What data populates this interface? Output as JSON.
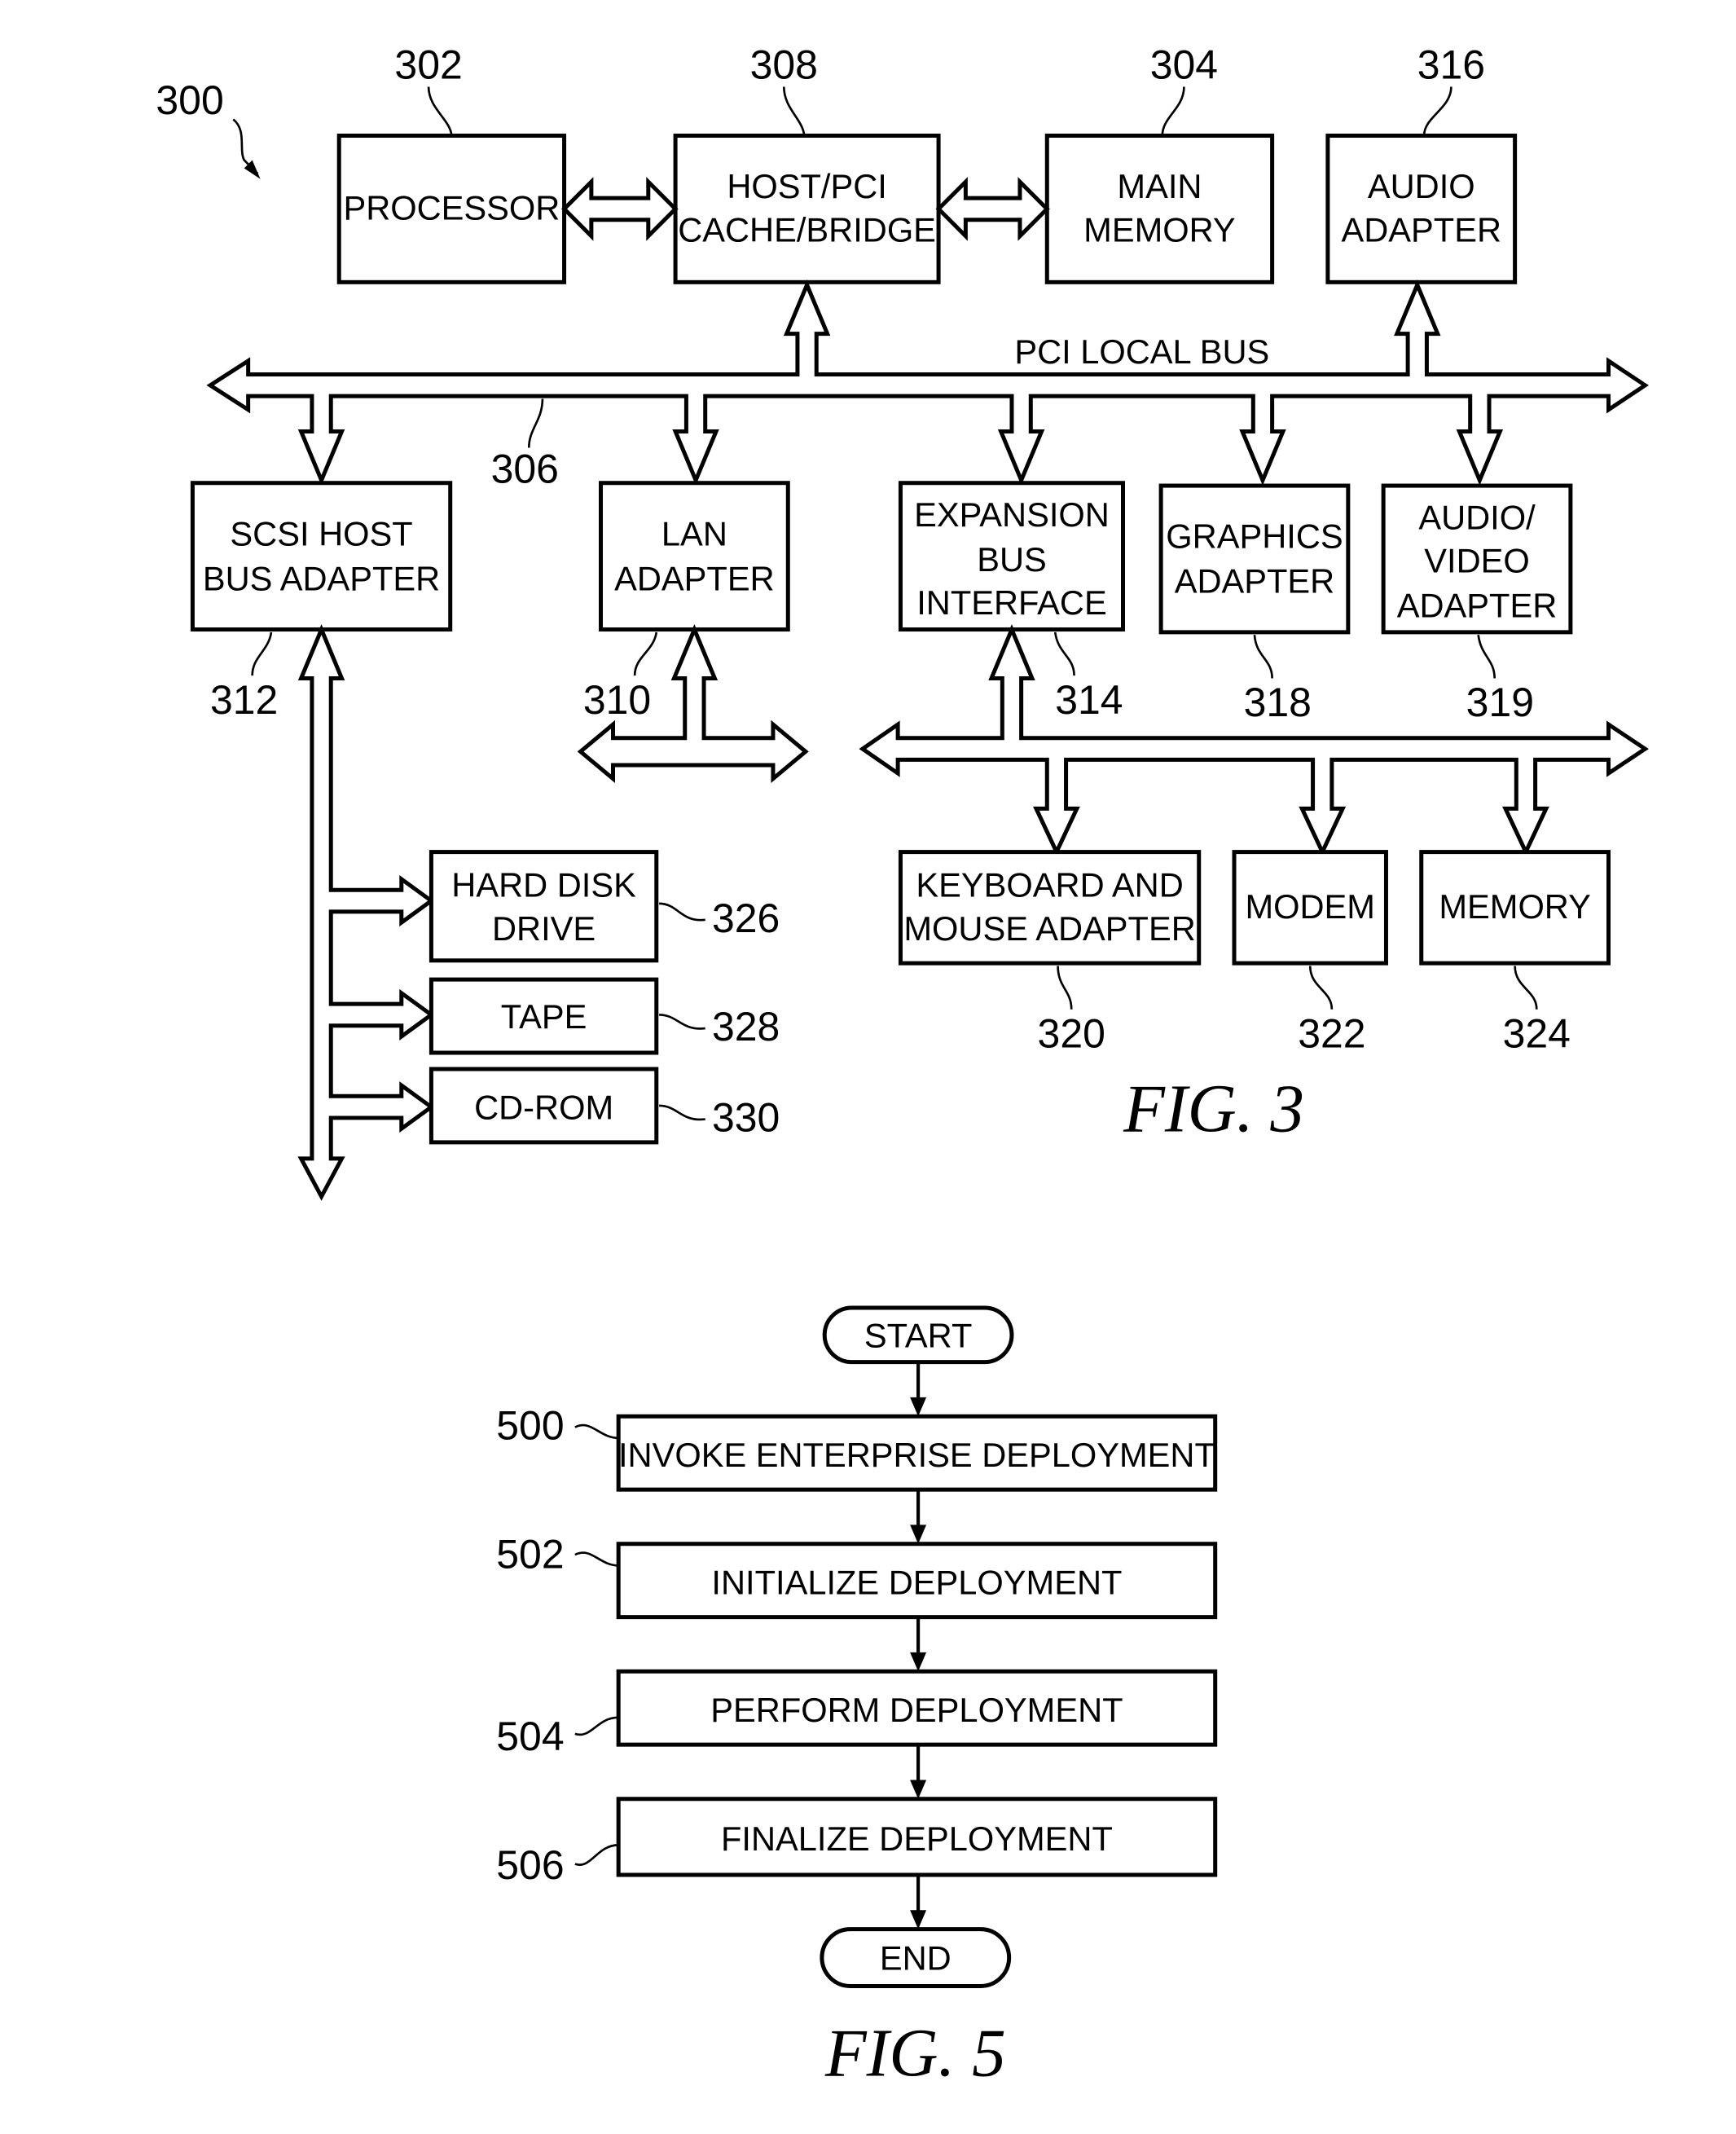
{
  "fig3": {
    "caption": "FIG. 3",
    "system_ref": "300",
    "bus_label": "PCI LOCAL BUS",
    "bus_ref": "306",
    "blocks": {
      "processor": {
        "ref": "302",
        "lines": [
          "PROCESSOR"
        ]
      },
      "bridge": {
        "ref": "308",
        "lines": [
          "HOST/PCI",
          "CACHE/BRIDGE"
        ]
      },
      "main_memory": {
        "ref": "304",
        "lines": [
          "MAIN",
          "MEMORY"
        ]
      },
      "audio_adapter": {
        "ref": "316",
        "lines": [
          "AUDIO",
          "ADAPTER"
        ]
      },
      "scsi": {
        "ref": "312",
        "lines": [
          "SCSI HOST",
          "BUS ADAPTER"
        ]
      },
      "lan": {
        "ref": "310",
        "lines": [
          "LAN",
          "ADAPTER"
        ]
      },
      "expansion": {
        "ref": "314",
        "lines": [
          "EXPANSION",
          "BUS",
          "INTERFACE"
        ]
      },
      "graphics": {
        "ref": "318",
        "lines": [
          "GRAPHICS",
          "ADAPTER"
        ]
      },
      "av_adapter": {
        "ref": "319",
        "lines": [
          "AUDIO/",
          "VIDEO",
          "ADAPTER"
        ]
      },
      "keyboard": {
        "ref": "320",
        "lines": [
          "KEYBOARD AND",
          "MOUSE ADAPTER"
        ]
      },
      "modem": {
        "ref": "322",
        "lines": [
          "MODEM"
        ]
      },
      "memory": {
        "ref": "324",
        "lines": [
          "MEMORY"
        ]
      },
      "hdd": {
        "ref": "326",
        "lines": [
          "HARD DISK",
          "DRIVE"
        ]
      },
      "tape": {
        "ref": "328",
        "lines": [
          "TAPE"
        ]
      },
      "cdrom": {
        "ref": "330",
        "lines": [
          "CD-ROM"
        ]
      }
    }
  },
  "fig5": {
    "caption": "FIG. 5",
    "start": "START",
    "end": "END",
    "steps": [
      {
        "ref": "500",
        "label": "INVOKE ENTERPRISE DEPLOYMENT"
      },
      {
        "ref": "502",
        "label": "INITIALIZE DEPLOYMENT"
      },
      {
        "ref": "504",
        "label": "PERFORM DEPLOYMENT"
      },
      {
        "ref": "506",
        "label": "FINALIZE DEPLOYMENT"
      }
    ]
  }
}
